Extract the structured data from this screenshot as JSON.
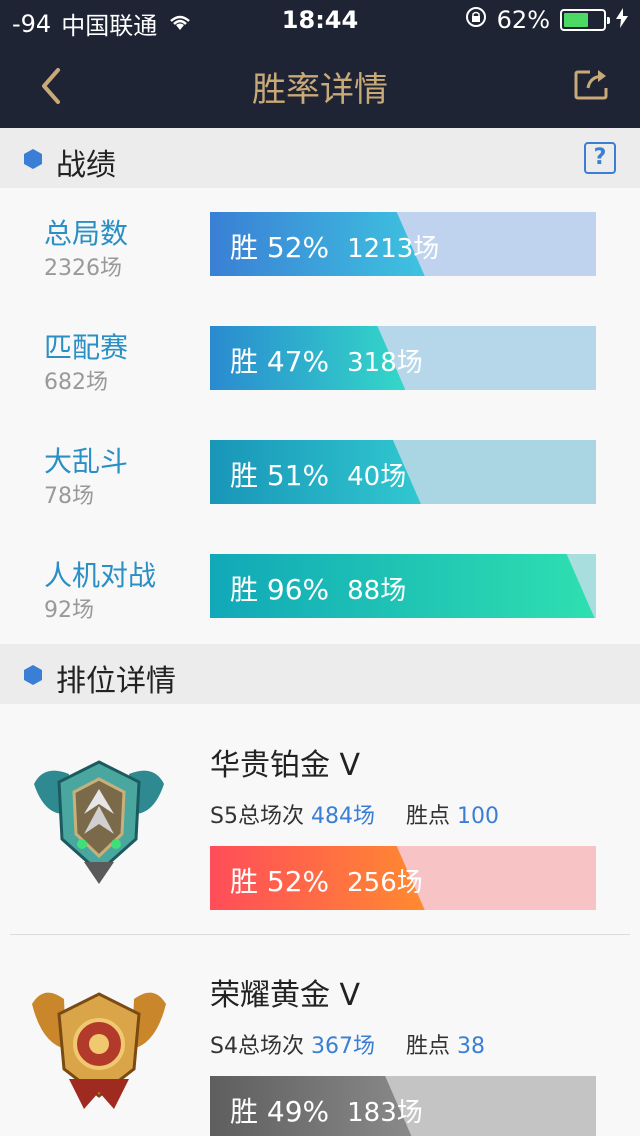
{
  "status": {
    "signal": "-94",
    "carrier": "中国联通",
    "time": "18:44",
    "battery": "62%",
    "battery_level": 0.62
  },
  "nav": {
    "title": "胜率详情"
  },
  "sections": {
    "record": "战绩",
    "help": "?",
    "rank": "排位详情"
  },
  "stats": [
    {
      "name": "总局数",
      "count": "2326场",
      "win": "胜 52%",
      "games": "1213场",
      "win_fraction": 0.52
    },
    {
      "name": "匹配赛",
      "count": "682场",
      "win": "胜 47%",
      "games": "318场",
      "win_fraction": 0.47
    },
    {
      "name": "大乱斗",
      "count": "78场",
      "win": "胜 51%",
      "games": "40场",
      "win_fraction": 0.51
    },
    {
      "name": "人机对战",
      "count": "92场",
      "win": "胜 96%",
      "games": "88场",
      "win_fraction": 0.96
    }
  ],
  "ranks": [
    {
      "name": "华贵铂金 V",
      "season_label": "S5总场次",
      "season_games": "484场",
      "points_label": "胜点",
      "points": "100",
      "win": "胜 52%",
      "games": "256场",
      "win_fraction": 0.52
    },
    {
      "name": "荣耀黄金 V",
      "season_label": "S4总场次",
      "season_games": "367场",
      "points_label": "胜点",
      "points": "38",
      "win": "胜 49%",
      "games": "183场",
      "win_fraction": 0.49
    }
  ],
  "colors": {
    "nav_bg": "#1f2434",
    "nav_title": "#c8a978",
    "accent_blue": "#3a7fd5",
    "platinum_bar": "#ff5a5a",
    "gold_bar": "#6f6f6f"
  }
}
